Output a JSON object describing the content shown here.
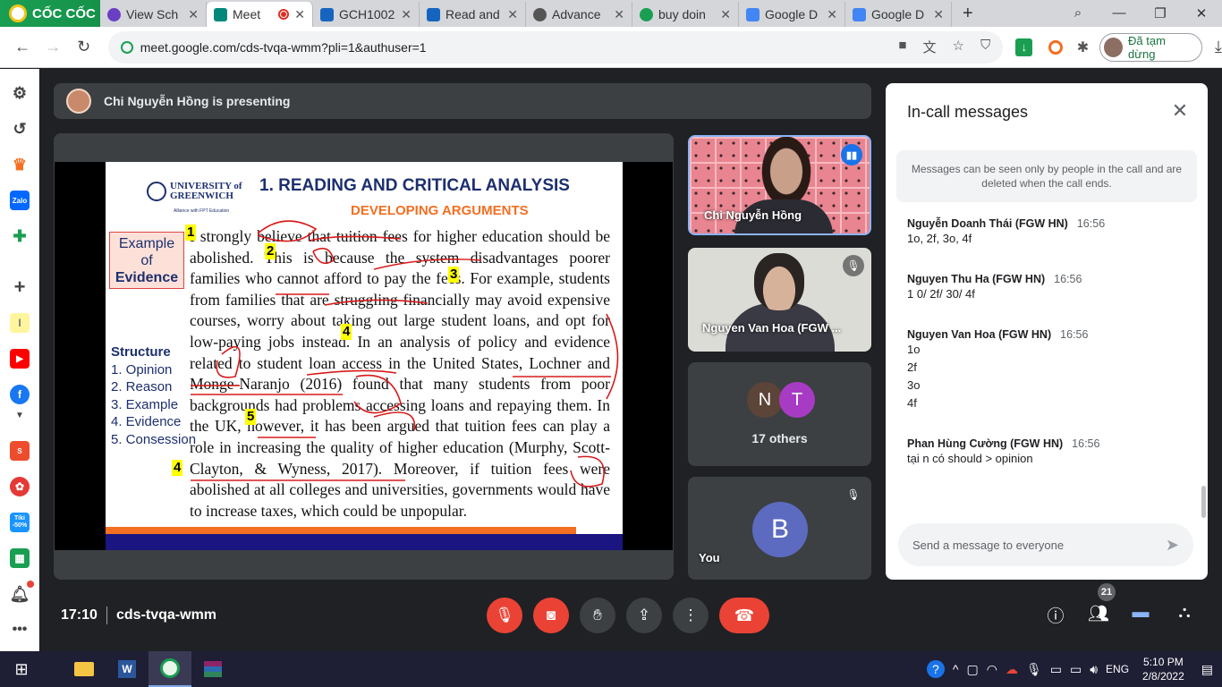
{
  "browser": {
    "brand": "CỐC CỐC",
    "tabs": [
      {
        "label": "View Sch",
        "color": "#6a3fc2"
      },
      {
        "label": "Meet",
        "color": "#00897b",
        "active": true
      },
      {
        "label": "GCH1002",
        "color": "#1565c0"
      },
      {
        "label": "Read and",
        "color": "#1565c0"
      },
      {
        "label": "Advance",
        "color": "#555555"
      },
      {
        "label": "buy doin",
        "color": "#1a9e52"
      },
      {
        "label": "Google D",
        "color": "#4285f4"
      },
      {
        "label": "Google D",
        "color": "#4285f4"
      }
    ],
    "new_tab": "+",
    "url": "meet.google.com/cds-tvqa-wmm?pli=1&authuser=1",
    "profile_status": "Đã tạm dừng"
  },
  "meet": {
    "presenting_banner": "Chi Nguyễn Hồng is presenting",
    "slide": {
      "title": "1. READING AND CRITICAL ANALYSIS",
      "subtitle": "DEVELOPING ARGUMENTS",
      "university": "UNIVERSITY of GREENWICH",
      "alliance": "Alliance with FPT Education",
      "example_box": [
        "Example",
        "of",
        "Evidence"
      ],
      "structure_heading": "Structure",
      "structure_items": [
        "1. Opinion",
        "2. Reason",
        "3. Example",
        "4. Evidence",
        "5. Consession"
      ],
      "body_text": "I strongly believe that tuition fees for higher education should be abolished. This is because the system disadvantages poorer families who cannot afford to pay the fees. For example, students from families that are struggling financially may avoid expensive courses, worry about taking out large student loans, and opt for low-paying jobs instead. In an analysis of policy and evidence related to student loan access in the United States, Lochner and Monge-Naranjo (2016) found that many students from poor backgrounds had problems accessing loans and repaying them. In the UK, however, it has been argued that tuition fees can play a role in increasing the quality of higher education (Murphy, Scott-Clayton, & Wyness, 2017). Moreover, if tuition fees were abolished at all colleges and universities, governments would have to increase taxes, which could be unpopular.",
      "markers": [
        "1",
        "2",
        "3",
        "4",
        "5",
        "4"
      ]
    },
    "participants": {
      "presenter": "Chi Nguyễn Hồng",
      "second": "Nguyen Van Hoa (FGW ...",
      "group_avatars": [
        "N",
        "T"
      ],
      "group_label": "17 others",
      "self_avatar": "B",
      "self_label": "You"
    },
    "chat": {
      "title": "In-call messages",
      "notice": "Messages can be seen only by people in the call and are deleted when the call ends.",
      "messages": [
        {
          "sender": "Nguyễn Doanh Thái (FGW HN)",
          "time": "16:56",
          "lines": [
            "1o, 2f, 3o, 4f"
          ]
        },
        {
          "sender": "Nguyen Thu Ha (FGW HN)",
          "time": "16:56",
          "lines": [
            "1 0/ 2f/ 30/ 4f"
          ]
        },
        {
          "sender": "Nguyen Van Hoa (FGW HN)",
          "time": "16:56",
          "lines": [
            "1o",
            "2f",
            "3o",
            "4f"
          ]
        },
        {
          "sender": "Phan Hùng Cường (FGW HN)",
          "time": "16:56",
          "lines": [
            "tại n có should > opinion"
          ]
        }
      ],
      "input_placeholder": "Send a message to everyone"
    },
    "bottom": {
      "time": "17:10",
      "meeting_code": "cds-tvqa-wmm",
      "people_count": "21"
    }
  },
  "taskbar": {
    "language": "ENG",
    "time": "5:10 PM",
    "date": "2/8/2022"
  }
}
